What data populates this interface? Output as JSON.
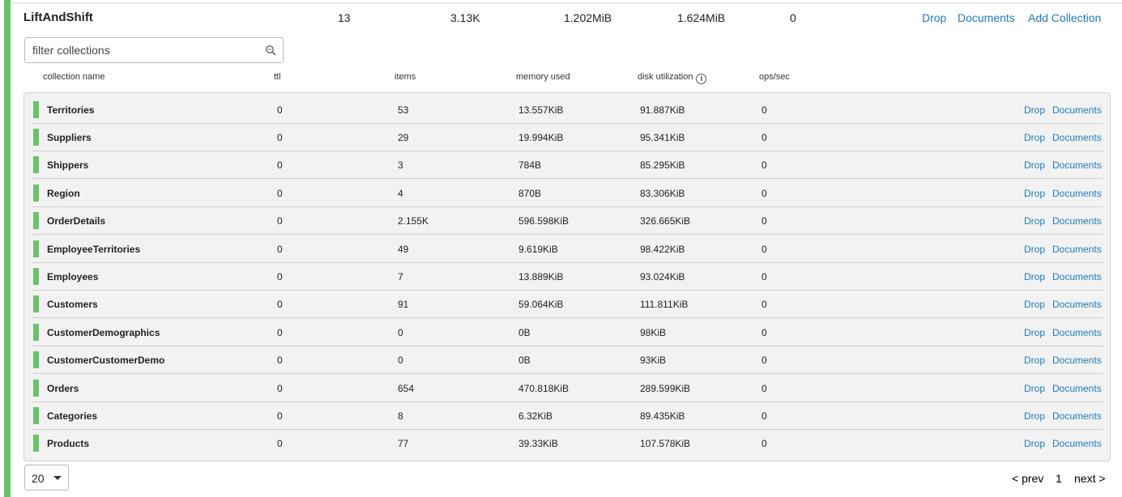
{
  "scope": {
    "name": "LiftAndShift",
    "collections_count": "13",
    "items": "3.13K",
    "memory_used": "1.202MiB",
    "disk_utilization": "1.624MiB",
    "ops_sec": "0",
    "actions": {
      "drop": "Drop",
      "documents": "Documents",
      "add_collection": "Add Collection"
    }
  },
  "filter": {
    "placeholder": "filter collections"
  },
  "columns": {
    "name": "collection name",
    "ttl": "ttl",
    "items": "items",
    "memory": "memory used",
    "disk": "disk utilization",
    "ops": "ops/sec"
  },
  "row_actions": {
    "drop": "Drop",
    "documents": "Documents"
  },
  "collections": [
    {
      "name": "Territories",
      "ttl": "0",
      "items": "53",
      "memory": "13.557KiB",
      "disk": "91.887KiB",
      "ops": "0"
    },
    {
      "name": "Suppliers",
      "ttl": "0",
      "items": "29",
      "memory": "19.994KiB",
      "disk": "95.341KiB",
      "ops": "0"
    },
    {
      "name": "Shippers",
      "ttl": "0",
      "items": "3",
      "memory": "784B",
      "disk": "85.295KiB",
      "ops": "0"
    },
    {
      "name": "Region",
      "ttl": "0",
      "items": "4",
      "memory": "870B",
      "disk": "83.306KiB",
      "ops": "0"
    },
    {
      "name": "OrderDetails",
      "ttl": "0",
      "items": "2.155K",
      "memory": "596.598KiB",
      "disk": "326.665KiB",
      "ops": "0"
    },
    {
      "name": "EmployeeTerritories",
      "ttl": "0",
      "items": "49",
      "memory": "9.619KiB",
      "disk": "98.422KiB",
      "ops": "0"
    },
    {
      "name": "Employees",
      "ttl": "0",
      "items": "7",
      "memory": "13.889KiB",
      "disk": "93.024KiB",
      "ops": "0"
    },
    {
      "name": "Customers",
      "ttl": "0",
      "items": "91",
      "memory": "59.064KiB",
      "disk": "111.811KiB",
      "ops": "0"
    },
    {
      "name": "CustomerDemographics",
      "ttl": "0",
      "items": "0",
      "memory": "0B",
      "disk": "98KiB",
      "ops": "0"
    },
    {
      "name": "CustomerCustomerDemo",
      "ttl": "0",
      "items": "0",
      "memory": "0B",
      "disk": "93KiB",
      "ops": "0"
    },
    {
      "name": "Orders",
      "ttl": "0",
      "items": "654",
      "memory": "470.818KiB",
      "disk": "289.599KiB",
      "ops": "0"
    },
    {
      "name": "Categories",
      "ttl": "0",
      "items": "8",
      "memory": "6.32KiB",
      "disk": "89.435KiB",
      "ops": "0"
    },
    {
      "name": "Products",
      "ttl": "0",
      "items": "77",
      "memory": "39.33KiB",
      "disk": "107.578KiB",
      "ops": "0"
    }
  ],
  "pagination": {
    "page_size": "20",
    "prev": "< prev",
    "current": "1",
    "next": "next >"
  },
  "colors": {
    "status_green": "#6cc26a",
    "link_blue": "#1e7bc4"
  },
  "icons": {
    "filter": "search-icon",
    "disk_info": "info-icon",
    "page_size": "chevron-down-icon"
  }
}
